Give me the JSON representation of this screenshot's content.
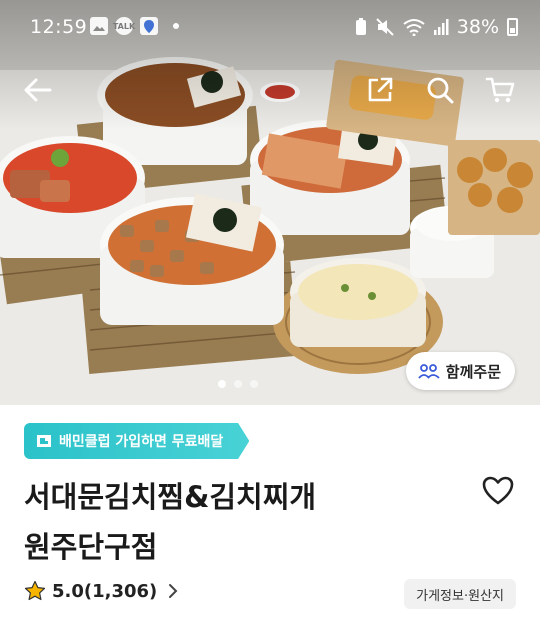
{
  "status_bar": {
    "time": "12:59",
    "battery": "38%",
    "talk_label": "TALK"
  },
  "nav": {
    "back_icon": "arrow-left-icon",
    "share_icon": "share-icon",
    "search_icon": "search-icon",
    "cart_icon": "cart-icon"
  },
  "hero": {
    "group_order_label": "함께주문",
    "carousel_active_index": 0
  },
  "store": {
    "club_badge": "배민클럽 가입하면 무료배달",
    "name_line1": "서대문김치찜&김치찌개",
    "name_line2": "원주단구점",
    "rating": "5.0(1,306)",
    "info_button": "가게정보·원산지"
  },
  "colors": {
    "accent": "#2bc2c9",
    "star": "#f7b500",
    "text": "#1a1a1a"
  }
}
